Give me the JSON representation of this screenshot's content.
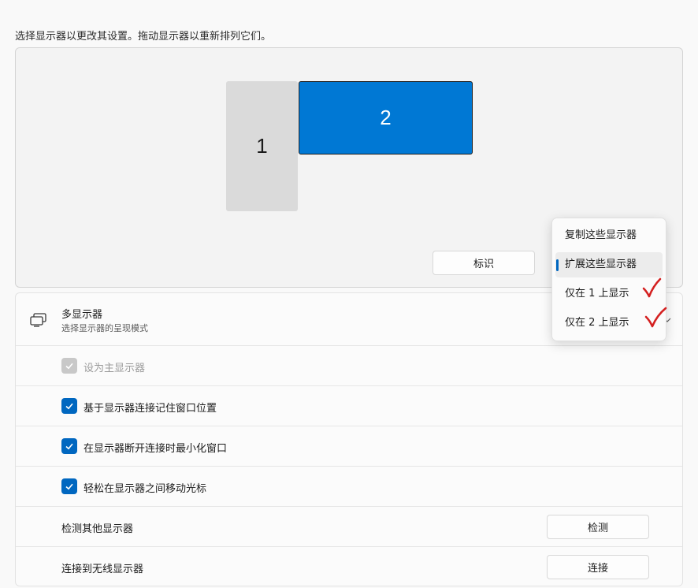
{
  "instruction": "选择显示器以更改其设置。拖动显示器以重新排列它们。",
  "monitors": [
    {
      "number": "1",
      "selected": false
    },
    {
      "number": "2",
      "selected": true
    }
  ],
  "identify_label": "标识",
  "multiple_displays": {
    "title": "多显示器",
    "subtitle": "选择显示器的呈现模式",
    "icon": "multiple-displays-icon"
  },
  "dropdown": {
    "options": [
      {
        "label": "复制这些显示器",
        "selected": false
      },
      {
        "label": "扩展这些显示器",
        "selected": true
      },
      {
        "label": "仅在 1 上显示",
        "selected": false,
        "annotated": true
      },
      {
        "label": "仅在 2 上显示",
        "selected": false,
        "annotated": true
      }
    ]
  },
  "checkboxes": [
    {
      "label": "设为主显示器",
      "checked": true,
      "disabled": true
    },
    {
      "label": "基于显示器连接记住窗口位置",
      "checked": true,
      "disabled": false
    },
    {
      "label": "在显示器断开连接时最小化窗口",
      "checked": true,
      "disabled": false
    },
    {
      "label": "轻松在显示器之间移动光标",
      "checked": true,
      "disabled": false
    }
  ],
  "detect": {
    "label": "检测其他显示器",
    "button": "检测"
  },
  "wireless": {
    "label": "连接到无线显示器",
    "button": "连接"
  },
  "colors": {
    "accent": "#0067c0",
    "monitor_selected": "#0078d4",
    "monitor_unselected": "#dadada",
    "annotation": "#d42020"
  }
}
